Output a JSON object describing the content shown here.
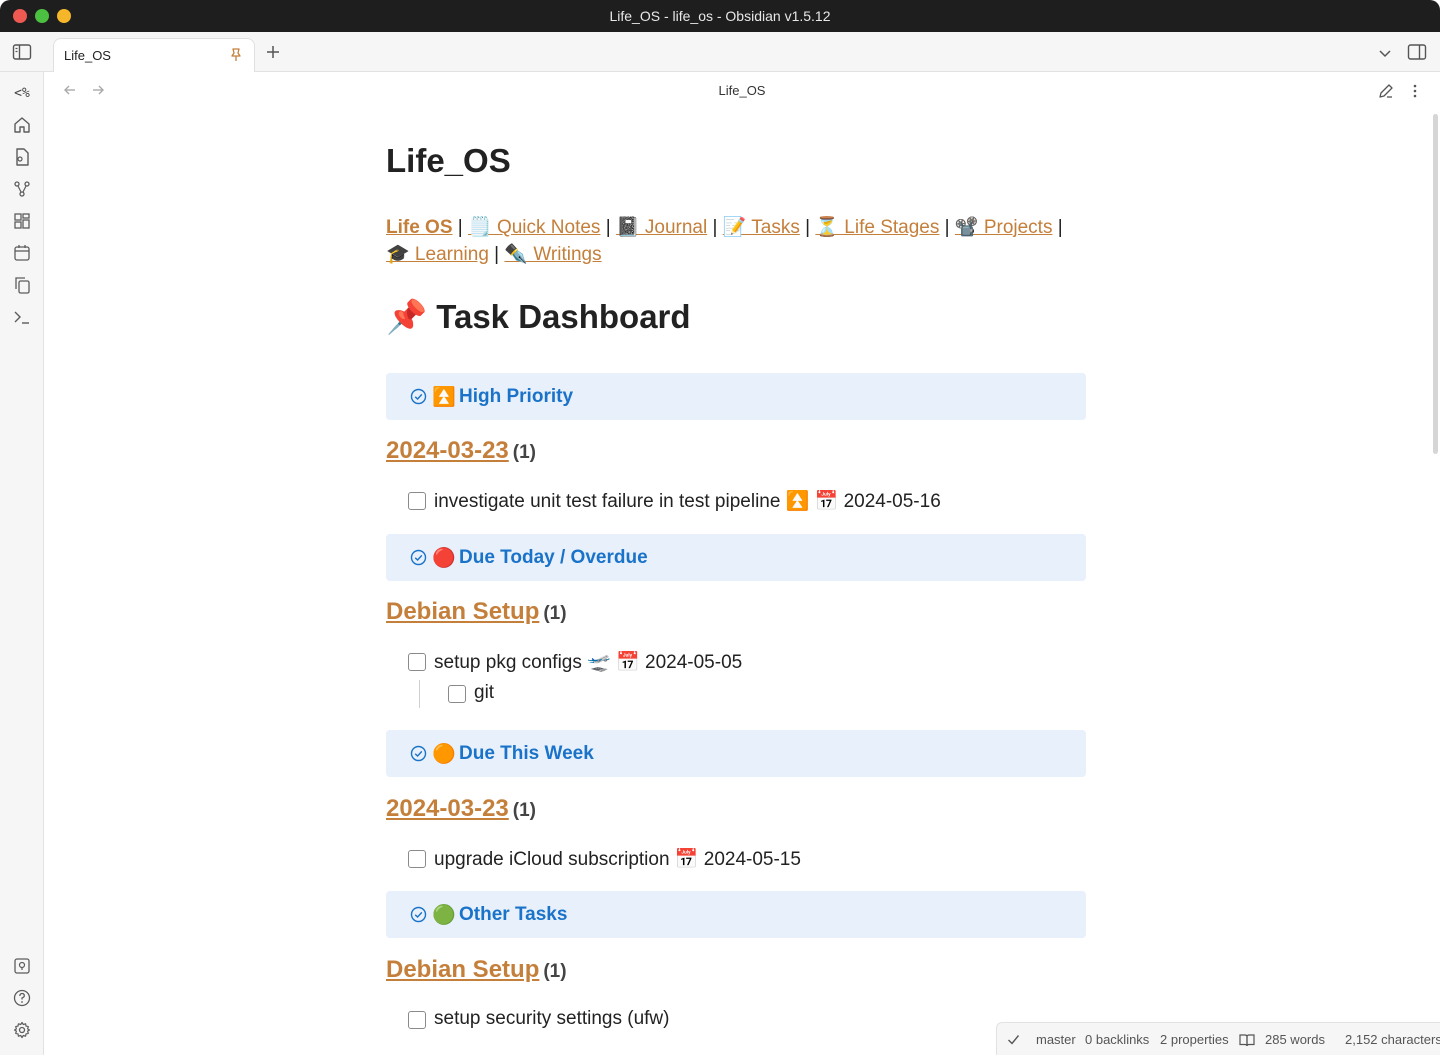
{
  "window": {
    "title": "Life_OS - life_os - Obsidian v1.5.12"
  },
  "tabs": [
    {
      "label": "Life_OS"
    }
  ],
  "view": {
    "title": "Life_OS"
  },
  "ribbon": {
    "templater_label": "<%"
  },
  "document": {
    "title": "Life_OS",
    "nav_links": [
      {
        "label": "Life OS"
      },
      {
        "label": "🗒️ Quick Notes"
      },
      {
        "label": "📓 Journal"
      },
      {
        "label": "📝 Tasks"
      },
      {
        "label": "⏳ Life Stages"
      },
      {
        "label": "📽️ Projects"
      },
      {
        "label": "🎓 Learning"
      },
      {
        "label": "✒️ Writings"
      }
    ],
    "separator": "|",
    "heading": "📌 Task Dashboard",
    "sections": [
      {
        "emoji": "⏫",
        "title": "High Priority",
        "group": "2024-03-23",
        "count": "(1)",
        "tasks": [
          {
            "text": "investigate unit test failure in test pipeline ⏫ 📅 2024-05-16"
          }
        ]
      },
      {
        "emoji": "🔴",
        "title": "Due Today / Overdue",
        "group": "Debian Setup",
        "count": "(1)",
        "tasks": [
          {
            "text": "setup pkg configs 🛫 📅 2024-05-05"
          },
          {
            "text": "git"
          }
        ]
      },
      {
        "emoji": "🟠",
        "title": "Due This Week",
        "group": "2024-03-23",
        "count": "(1)",
        "tasks": [
          {
            "text": "upgrade iCloud subscription 📅 2024-05-15"
          }
        ]
      },
      {
        "emoji": "🟢",
        "title": "Other Tasks",
        "group": "Debian Setup",
        "count": "(1)",
        "tasks": [
          {
            "text": "setup security settings (ufw)"
          }
        ]
      }
    ]
  },
  "statusbar": {
    "branch": "master",
    "backlinks": "0 backlinks",
    "properties": "2 properties",
    "words": "285 words",
    "characters": "2,152 characters"
  },
  "colors": {
    "link": "#c47f3b",
    "callout_bg": "#e7f0fb",
    "callout_title": "#1a73c8"
  }
}
